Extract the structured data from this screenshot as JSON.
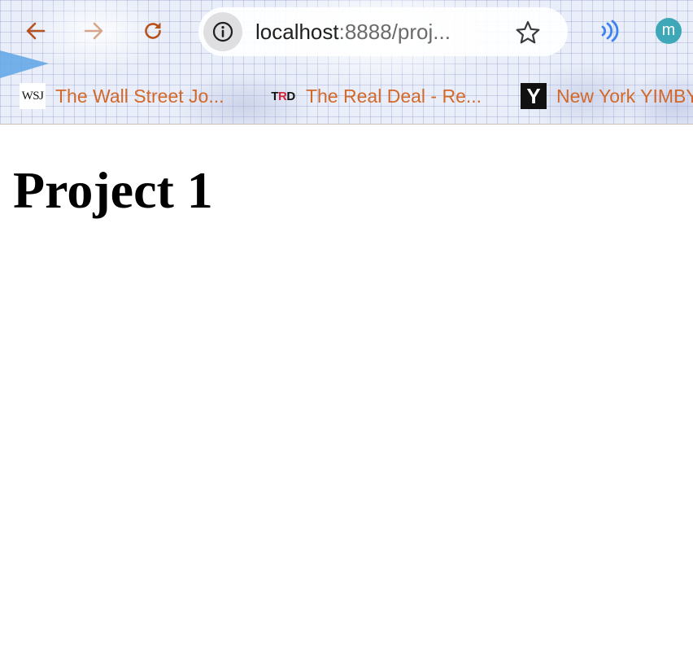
{
  "browser": {
    "url_host": "localhost",
    "url_rest": ":8888/proj...",
    "profile_initial": "m",
    "bookmarks": [
      {
        "icon_text": "WSJ",
        "label": "The Wall Street Jo..."
      },
      {
        "icon_text": "TRD",
        "label": "The Real Deal - Re..."
      },
      {
        "icon_text": "Y",
        "label": "New York YIMBY"
      }
    ]
  },
  "page": {
    "title": "Project 1"
  },
  "colors": {
    "nav_icon": "#b5531f",
    "bookmark_text": "#d2692a",
    "extension_icon": "#3d82f0",
    "profile_avatar": "#3fa8b8"
  },
  "icons": [
    "back-arrow-icon",
    "forward-arrow-icon",
    "reload-icon",
    "info-icon",
    "star-icon",
    "audio-extension-icon",
    "profile-avatar"
  ]
}
